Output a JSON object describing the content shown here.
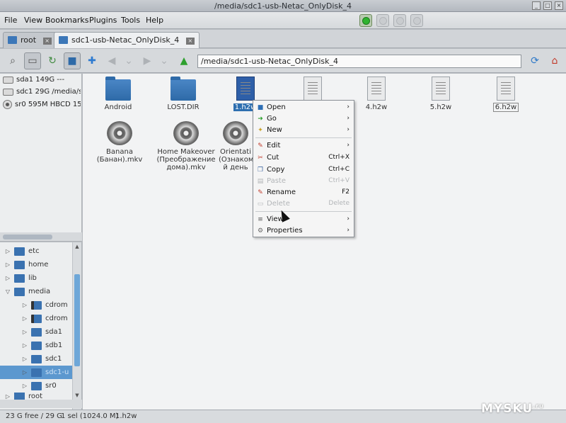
{
  "window": {
    "title": "/media/sdc1-usb-Netac_OnlyDisk_4"
  },
  "menubar": {
    "items": [
      "File",
      "View",
      "Bookmarks",
      "Plugins",
      "Tools",
      "Help"
    ]
  },
  "tabs": [
    {
      "label": "root"
    },
    {
      "label": "sdc1-usb-Netac_OnlyDisk_4"
    }
  ],
  "address": {
    "value": "/media/sdc1-usb-Netac_OnlyDisk_4"
  },
  "places": [
    {
      "label": "sda1 149G ---"
    },
    {
      "label": "sdc1 29G /media/sd"
    },
    {
      "label": "sr0 595M HBCD 15.2"
    }
  ],
  "tree": [
    {
      "label": "etc"
    },
    {
      "label": "home"
    },
    {
      "label": "lib"
    },
    {
      "label": "media"
    },
    {
      "label": "cdrom"
    },
    {
      "label": "cdrom"
    },
    {
      "label": "sda1"
    },
    {
      "label": "sdb1"
    },
    {
      "label": "sdc1"
    },
    {
      "label": "sdc1-u"
    },
    {
      "label": "sr0"
    },
    {
      "label": "root"
    }
  ],
  "files": [
    {
      "name": "Android"
    },
    {
      "name": "LOST.DIR"
    },
    {
      "name": "1.h2w"
    },
    {
      "name": "4.h2w"
    },
    {
      "name": "5.h2w"
    },
    {
      "name": "6.h2w"
    },
    {
      "name": "Banana (Банан).mkv"
    },
    {
      "name": "Home Makeover (Преображение дома).mkv"
    },
    {
      "name": "Orientati (Ознаком й день"
    }
  ],
  "context_menu": {
    "open": "Open",
    "go": "Go",
    "new": "New",
    "edit": "Edit",
    "cut": "Cut",
    "cut_shortcut": "Ctrl+X",
    "copy": "Copy",
    "copy_shortcut": "Ctrl+C",
    "paste": "Paste",
    "paste_shortcut": "Ctrl+V",
    "rename": "Rename",
    "rename_shortcut": "F2",
    "delete": "Delete",
    "delete_shortcut": "Delete",
    "view": "View",
    "properties": "Properties"
  },
  "status": {
    "free": "23 G free / 29 G",
    "selection": "1 sel (1024.0 M)",
    "selected_name": "1.h2w"
  },
  "watermark": {
    "text": "MYSKU",
    "suffix": ".ru"
  },
  "colors": {
    "folder": "#3a72b0",
    "selection": "#5c98cf",
    "go_green": "#2fb32f"
  }
}
